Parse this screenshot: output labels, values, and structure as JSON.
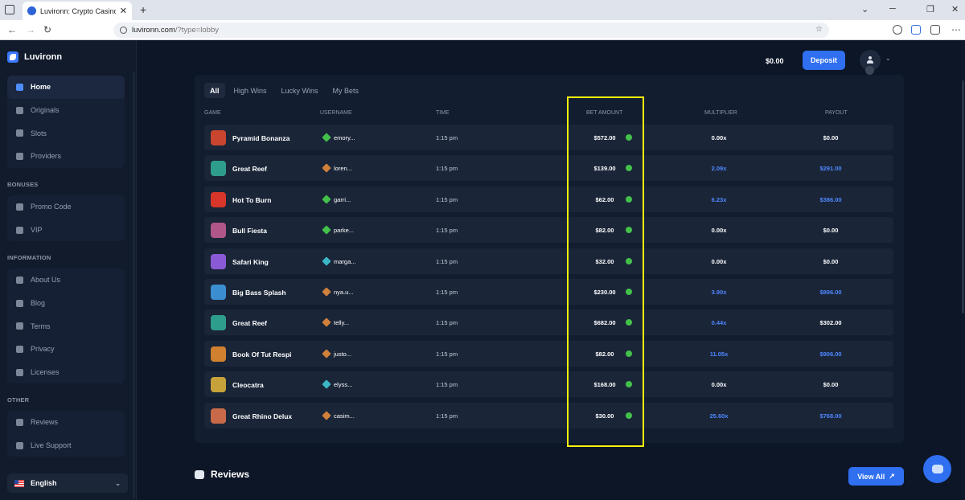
{
  "browser": {
    "tab_title": "Luvironn: Crypto Casino Games",
    "url_host": "luvironn.com",
    "url_path": "/?type=lobby"
  },
  "sidebar": {
    "brand": "Luvironn",
    "main_items": [
      {
        "label": "Home",
        "icon": "home-icon"
      },
      {
        "label": "Originals",
        "icon": "flame-icon"
      },
      {
        "label": "Slots",
        "icon": "slots-icon"
      },
      {
        "label": "Providers",
        "icon": "grid-icon"
      }
    ],
    "bonuses_label": "BONUSES",
    "bonus_items": [
      {
        "label": "Promo Code",
        "icon": "ticket-icon"
      },
      {
        "label": "VIP",
        "icon": "crown-icon"
      }
    ],
    "information_label": "INFORMATION",
    "info_items": [
      {
        "label": "About Us",
        "icon": "info-icon"
      },
      {
        "label": "Blog",
        "icon": "blog-icon"
      },
      {
        "label": "Terms",
        "icon": "document-icon"
      },
      {
        "label": "Privacy",
        "icon": "shield-icon"
      },
      {
        "label": "Licenses",
        "icon": "license-icon"
      }
    ],
    "other_label": "OTHER",
    "other_items": [
      {
        "label": "Reviews",
        "icon": "chat-icon"
      },
      {
        "label": "Live Support",
        "icon": "headset-icon"
      }
    ],
    "language": "English"
  },
  "header": {
    "balance": "$0.00",
    "deposit_label": "Deposit"
  },
  "bets": {
    "tabs": [
      "All",
      "High Wins",
      "Lucky Wins",
      "My Bets"
    ],
    "columns": [
      "GAME",
      "USERNAME",
      "TIME",
      "BET AMOUNT",
      "MULTIPLIER",
      "PAYOUT"
    ],
    "rows": [
      {
        "game": "Pyramid Bonanza",
        "user": "emory...",
        "time": "1:15 pm",
        "bet": "$572.00",
        "multiplier": "0.00x",
        "payout": "$0.00",
        "win": false
      },
      {
        "game": "Great Reef",
        "user": "loren...",
        "time": "1:15 pm",
        "bet": "$139.00",
        "multiplier": "2.09x",
        "payout": "$291.00",
        "win": true
      },
      {
        "game": "Hot To Burn",
        "user": "garri...",
        "time": "1:15 pm",
        "bet": "$62.00",
        "multiplier": "6.23x",
        "payout": "$386.00",
        "win": true
      },
      {
        "game": "Bull Fiesta",
        "user": "parke...",
        "time": "1:15 pm",
        "bet": "$82.00",
        "multiplier": "0.00x",
        "payout": "$0.00",
        "win": false
      },
      {
        "game": "Safari King",
        "user": "marga...",
        "time": "1:15 pm",
        "bet": "$32.00",
        "multiplier": "0.00x",
        "payout": "$0.00",
        "win": false
      },
      {
        "game": "Big Bass Splash",
        "user": "nya.u...",
        "time": "1:15 pm",
        "bet": "$230.00",
        "multiplier": "3.90x",
        "payout": "$896.00",
        "win": true
      },
      {
        "game": "Great Reef",
        "user": "telly...",
        "time": "1:15 pm",
        "bet": "$682.00",
        "multiplier": "0.44x",
        "payout": "$302.00",
        "win": true,
        "payout_white": true
      },
      {
        "game": "Book Of Tut Respi",
        "user": "justo...",
        "time": "1:15 pm",
        "bet": "$82.00",
        "multiplier": "11.05x",
        "payout": "$906.00",
        "win": true
      },
      {
        "game": "Cleocatra",
        "user": "elyss...",
        "time": "1:15 pm",
        "bet": "$168.00",
        "multiplier": "0.00x",
        "payout": "$0.00",
        "win": false
      },
      {
        "game": "Great Rhino Delux",
        "user": "casim...",
        "time": "1:15 pm",
        "bet": "$30.00",
        "multiplier": "25.60x",
        "payout": "$768.00",
        "win": true
      }
    ]
  },
  "reviews": {
    "title": "Reviews",
    "view_all_label": "View All"
  },
  "colors": {
    "accent": "#2f6ff0",
    "win_blue": "#4f88ff",
    "highlight": "#f5f20d",
    "coin_green": "#43c14a"
  }
}
